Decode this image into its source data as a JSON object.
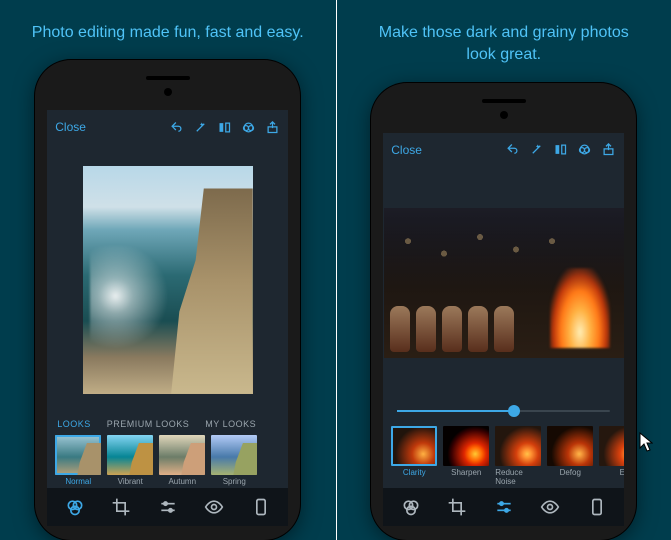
{
  "left": {
    "headline": "Photo editing made fun, fast and easy.",
    "close_label": "Close",
    "category_tabs": [
      "LOOKS",
      "PREMIUM LOOKS",
      "MY LOOKS"
    ],
    "active_category_index": 0,
    "thumbnails": [
      {
        "label": "Normal"
      },
      {
        "label": "Vibrant"
      },
      {
        "label": "Autumn"
      },
      {
        "label": "Spring"
      }
    ],
    "active_thumb_index": 0
  },
  "right": {
    "headline": "Make those dark and grainy photos look great.",
    "close_label": "Close",
    "slider_value_percent": 55,
    "thumbnails": [
      {
        "label": "Clarity"
      },
      {
        "label": "Sharpen"
      },
      {
        "label": "Reduce Noise"
      },
      {
        "label": "Defog"
      },
      {
        "label": "E"
      }
    ],
    "active_thumb_index": 0,
    "active_tool_index": 2
  },
  "top_icons": [
    "undo-icon",
    "auto-enhance-icon",
    "compare-icon",
    "cloud-icon",
    "share-icon"
  ],
  "bottom_tools": [
    "looks-icon",
    "crop-icon",
    "adjust-icon",
    "redeye-icon",
    "blemish-icon"
  ],
  "colors": {
    "accent": "#3da8e6",
    "bg_panel": "#003d4d",
    "bg_screen": "#1e2730"
  }
}
